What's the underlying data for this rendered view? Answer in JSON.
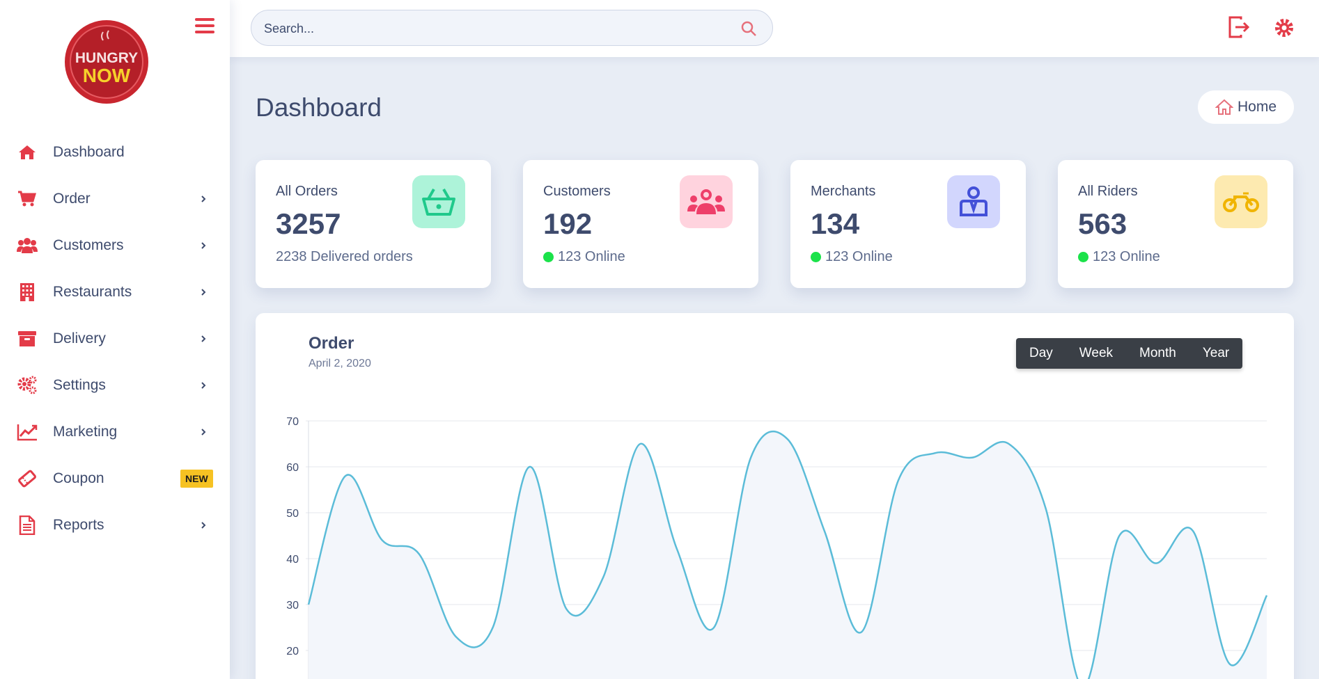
{
  "brand": {
    "logo_text_top": "HUNGRY",
    "logo_text_bottom": "NOW",
    "red": "#e33b48"
  },
  "sidebar": {
    "items": [
      {
        "label": "Dashboard",
        "icon": "home-icon",
        "chevron": false
      },
      {
        "label": "Order",
        "icon": "cart-icon",
        "chevron": true
      },
      {
        "label": "Customers",
        "icon": "users-icon",
        "chevron": true
      },
      {
        "label": "Restaurants",
        "icon": "building-icon",
        "chevron": true
      },
      {
        "label": "Delivery",
        "icon": "archive-box-icon",
        "chevron": true
      },
      {
        "label": "Settings",
        "icon": "gears-icon",
        "chevron": true
      },
      {
        "label": "Marketing",
        "icon": "trend-chart-icon",
        "chevron": true
      },
      {
        "label": "Coupon",
        "icon": "ticket-icon",
        "badge": "NEW"
      },
      {
        "label": "Reports",
        "icon": "document-icon",
        "chevron": true
      }
    ]
  },
  "search": {
    "placeholder": "Search..."
  },
  "header": {
    "title": "Dashboard",
    "breadcrumb": "Home"
  },
  "cards": [
    {
      "title": "All Orders",
      "value": "3257",
      "sub": "2238 Delivered orders",
      "icon": "basket-icon",
      "icon_bg": "#adf3d9",
      "icon_color": "#20c98b",
      "online_dot": false
    },
    {
      "title": "Customers",
      "value": "192",
      "sub": "123 Online",
      "icon": "group-icon",
      "icon_bg": "#ffd3de",
      "icon_color": "#ee3f6a",
      "online_dot": true
    },
    {
      "title": "Merchants",
      "value": "134",
      "sub": "123 Online",
      "icon": "merchant-icon",
      "icon_bg": "#d2d6fd",
      "icon_color": "#4350d8",
      "online_dot": true
    },
    {
      "title": "All Riders",
      "value": "563",
      "sub": "123 Online",
      "icon": "motorbike-icon",
      "icon_bg": "#fdeab0",
      "icon_color": "#f0b400",
      "online_dot": true
    }
  ],
  "chart": {
    "title": "Order",
    "date": "April 2, 2020",
    "ranges": [
      "Day",
      "Week",
      "Month",
      "Year"
    ]
  },
  "chart_data": {
    "type": "line",
    "title": "Order",
    "x": [
      0,
      1,
      2,
      3,
      4,
      5,
      6,
      7,
      8,
      9,
      10,
      11,
      12,
      13,
      14,
      15,
      16,
      17,
      18,
      19,
      20,
      21,
      22,
      23,
      24,
      25,
      26
    ],
    "series": [
      {
        "values": [
          30,
          58,
          44,
          41,
          23,
          25,
          60,
          29,
          36,
          65,
          42,
          25,
          62,
          66,
          46,
          24,
          57,
          63,
          62,
          65,
          51,
          12,
          45,
          39,
          46,
          17,
          32
        ]
      }
    ],
    "ylim": [
      20,
      70
    ],
    "yticks": [
      20,
      30,
      40,
      50,
      60,
      70
    ],
    "line_color": "#5bbcd8",
    "grid": true
  }
}
